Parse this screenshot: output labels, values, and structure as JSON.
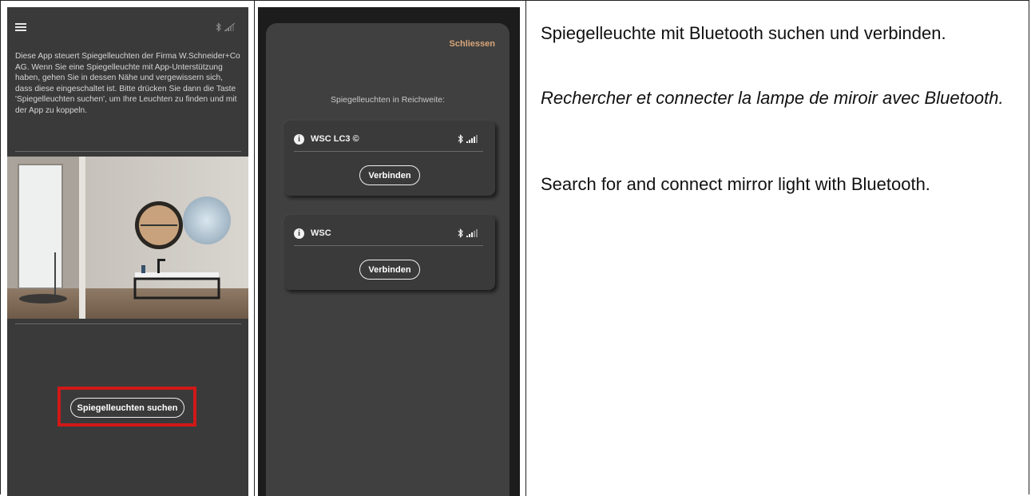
{
  "screen1": {
    "intro_text": "Diese App steuert Spiegelleuchten der Firma W.Schneider+Co AG. Wenn Sie eine Spiegelleuchte mit App-Unterstützung haben, gehen Sie in dessen Nähe und vergewissern sich, dass diese eingeschaltet ist. Bitte drücken Sie dann die Taste 'Spiegelleuchten suchen', um Ihre Leuchten zu finden und mit der App zu koppeln.",
    "search_button": "Spiegelleuchten suchen",
    "icons": [
      "hamburger-menu-icon",
      "bluetooth-signal-icon"
    ]
  },
  "screen2": {
    "close_label": "Schliessen",
    "range_label": "Spiegelleuchten in Reichweite:",
    "devices": [
      {
        "name": "WSC LC3 ©",
        "connect_label": "Verbinden"
      },
      {
        "name": "WSC",
        "connect_label": "Verbinden"
      }
    ]
  },
  "description": {
    "de": "Spiegelleuchte mit Bluetooth suchen und verbinden.",
    "fr": "Rechercher et connecter la lampe de miroir avec Bluetooth.",
    "en": "Search for and connect mirror light with Bluetooth."
  },
  "colors": {
    "highlight": "#d01818",
    "accent": "#d8a578",
    "phone_bg": "#3a3a3a"
  }
}
